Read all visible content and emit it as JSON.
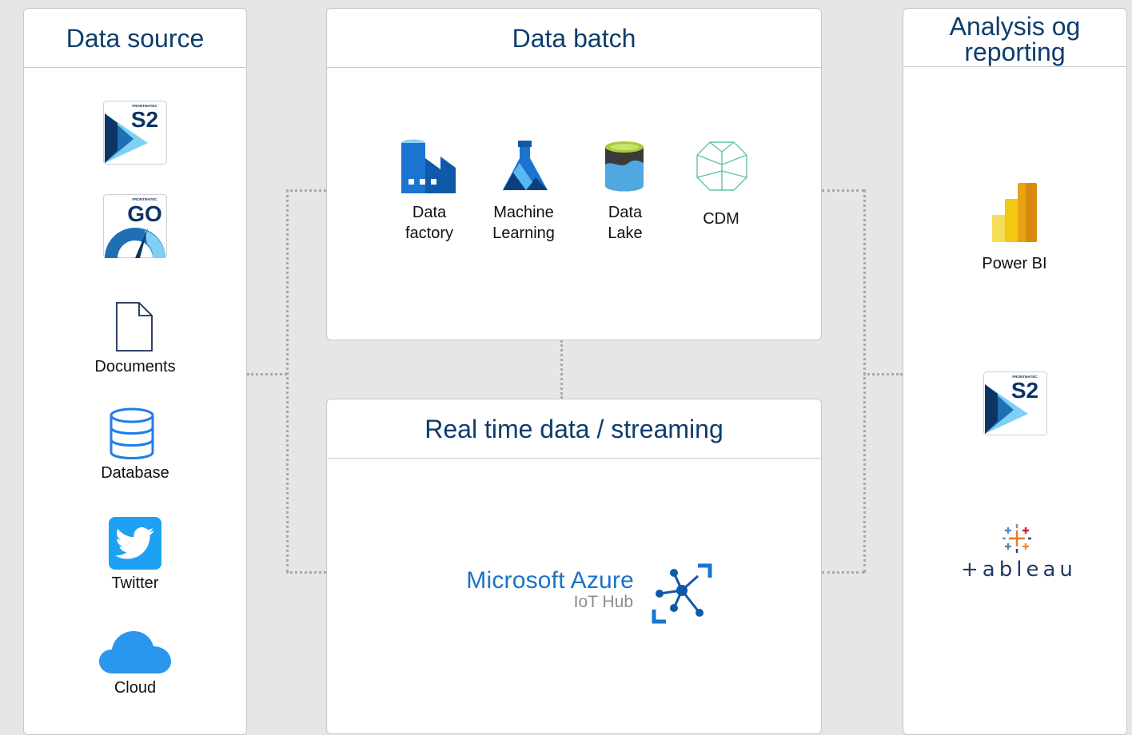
{
  "panels": {
    "source": {
      "title": "Data source"
    },
    "batch": {
      "title": "Data batch"
    },
    "realtime": {
      "title": "Real time data / streaming"
    },
    "analysis": {
      "title_line1": "Analysis og",
      "title_line2": "reporting"
    }
  },
  "source_items": {
    "s2_brand": "FRONTMATEC",
    "s2_text": "S2",
    "go_brand": "FRONTMATEC",
    "go_text": "GO",
    "documents": "Documents",
    "database": "Database",
    "twitter": "Twitter",
    "cloud": "Cloud"
  },
  "batch_items": {
    "factory_line1": "Data",
    "factory_line2": "factory",
    "ml_line1": "Machine",
    "ml_line2": "Learning",
    "lake_line1": "Data",
    "lake_line2": "Lake",
    "cdm": "CDM"
  },
  "realtime_items": {
    "azure_title": "Microsoft Azure",
    "azure_sub": "IoT Hub"
  },
  "analysis_items": {
    "powerbi": "Power BI",
    "s2_brand": "FRONTMATEC",
    "s2_text": "S2",
    "tableau": "+ableau"
  },
  "colors": {
    "header_text": "#0e3d6b",
    "azure_blue": "#1a73c8",
    "frontmatec_navy": "#0d3463",
    "twitter_blue": "#1da1f2",
    "cloud_blue": "#2a96ee",
    "powerbi_yellow": "#f2c811"
  }
}
